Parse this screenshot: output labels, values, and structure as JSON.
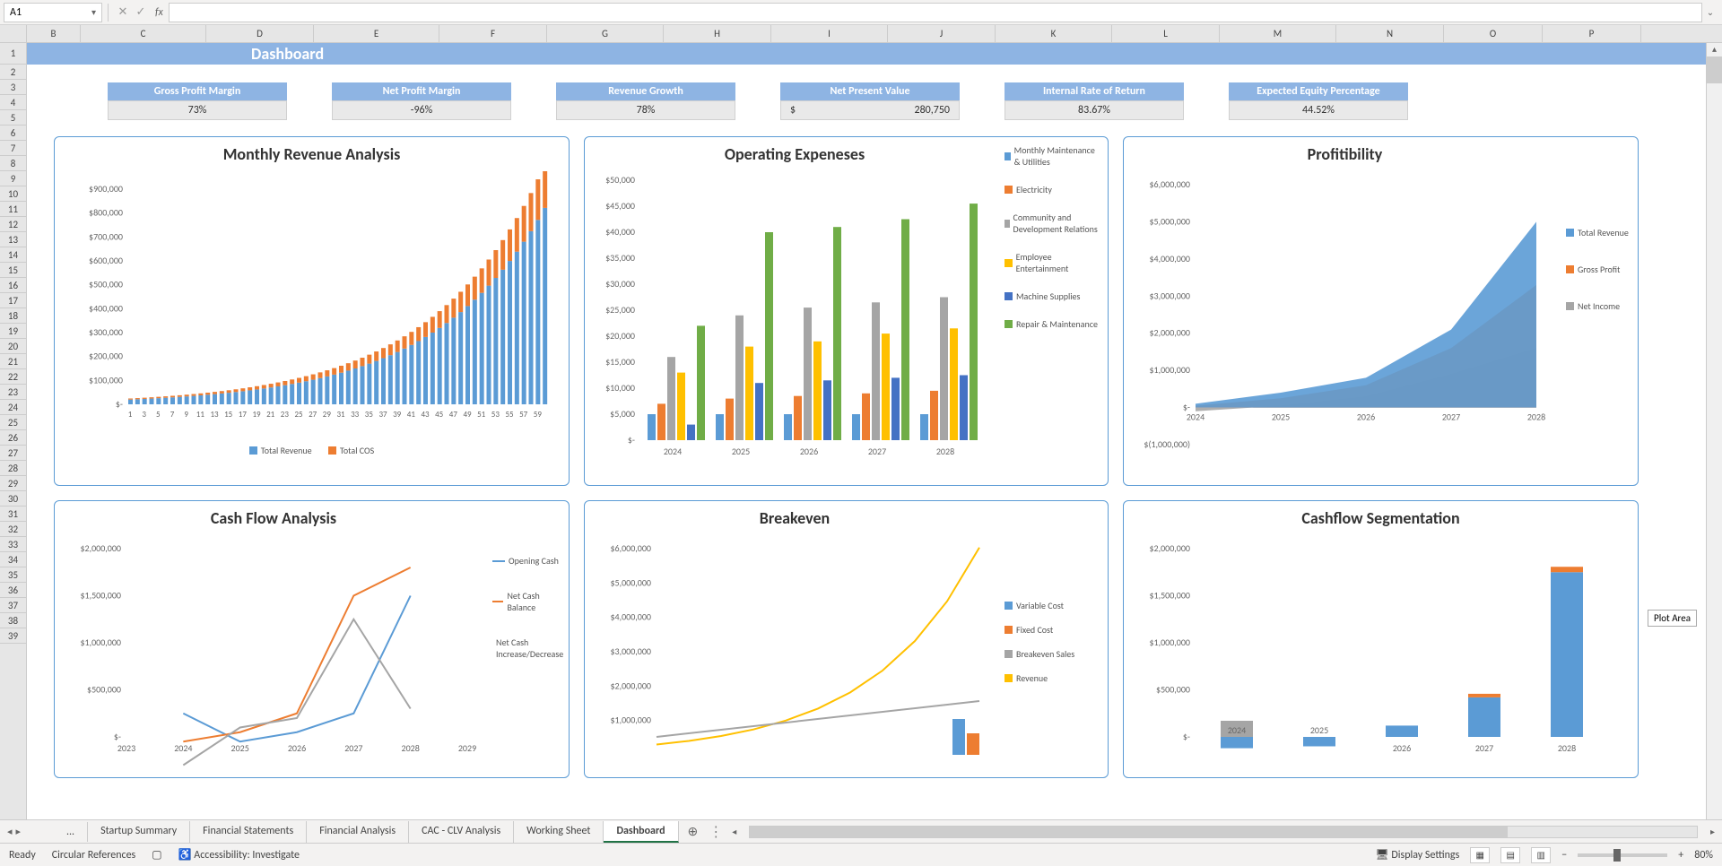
{
  "name_box": "A1",
  "fx_label": "fx",
  "columns": [
    "B",
    "C",
    "D",
    "E",
    "F",
    "G",
    "H",
    "I",
    "J",
    "K",
    "L",
    "M",
    "N",
    "O",
    "P"
  ],
  "rows": [
    1,
    2,
    3,
    4,
    5,
    6,
    7,
    8,
    9,
    10,
    11,
    12,
    13,
    14,
    15,
    16,
    17,
    18,
    19,
    20,
    21,
    22,
    23,
    24,
    25,
    26,
    27,
    28,
    29,
    30,
    31,
    32,
    33,
    34,
    35,
    36,
    37,
    38,
    39
  ],
  "dash_title": "Dashboard",
  "kpis": [
    {
      "label": "Gross Profit Margin",
      "value": "73%"
    },
    {
      "label": "Net Profit Margin",
      "value": "-96%"
    },
    {
      "label": "Revenue Growth",
      "value": "78%"
    },
    {
      "label": "Net Present Value",
      "prefix": "$",
      "value": "280,750"
    },
    {
      "label": "Internal Rate of Return",
      "value": "83.67%"
    },
    {
      "label": "Expected Equity Percentage",
      "value": "44.52%"
    }
  ],
  "chart_titles": {
    "revenue": "Monthly Revenue Analysis",
    "expenses": "Operating Expeneses",
    "profit": "Profitibility",
    "cashflow": "Cash Flow Analysis",
    "breakeven": "Breakeven",
    "cashseg": "Cashflow Segmentation"
  },
  "tooltip": "Plot Area",
  "tabs": {
    "ellipsis": "...",
    "items": [
      "Startup Summary",
      "Financial Statements",
      "Financial Analysis",
      "CAC - CLV Analysis",
      "Working Sheet",
      "Dashboard"
    ],
    "active": "Dashboard"
  },
  "status": {
    "ready": "Ready",
    "circular": "Circular References",
    "accessibility": "Accessibility: Investigate",
    "display": "Display Settings",
    "zoom": "80%"
  },
  "chart_data": [
    {
      "id": "monthly_revenue",
      "type": "bar",
      "title": "Monthly Revenue Analysis",
      "ylabel": "",
      "xlabel": "",
      "ylim": [
        0,
        900000
      ],
      "yticks": [
        "$-",
        "$100,000",
        "$200,000",
        "$300,000",
        "$400,000",
        "$500,000",
        "$600,000",
        "$700,000",
        "$800,000",
        "$900,000"
      ],
      "categories": [
        1,
        3,
        5,
        7,
        9,
        11,
        13,
        15,
        17,
        19,
        21,
        23,
        25,
        27,
        29,
        31,
        33,
        35,
        37,
        39,
        41,
        43,
        45,
        47,
        49,
        51,
        53,
        55,
        57,
        59
      ],
      "series": [
        {
          "name": "Total Revenue",
          "color": "#5B9BD5"
        },
        {
          "name": "Total COS",
          "color": "#ED7D31"
        }
      ],
      "note": "60 stacked bars growing exponentially from ~20000 to ~800000; Total COS caps each Total Revenue bar (~15-25%)."
    },
    {
      "id": "operating_expenses",
      "type": "bar",
      "title": "Operating Expeneses",
      "ylim": [
        0,
        50000
      ],
      "yticks": [
        "$-",
        "$5,000",
        "$10,000",
        "$15,000",
        "$20,000",
        "$25,000",
        "$30,000",
        "$35,000",
        "$40,000",
        "$45,000",
        "$50,000"
      ],
      "categories": [
        "2024",
        "2025",
        "2026",
        "2027",
        "2028"
      ],
      "series": [
        {
          "name": "Monthly Maintenance & Utilities",
          "color": "#5B9BD5",
          "values": [
            5000,
            5000,
            5000,
            5000,
            5000
          ]
        },
        {
          "name": "Electricity",
          "color": "#ED7D31",
          "values": [
            7000,
            8000,
            8500,
            9000,
            9500
          ]
        },
        {
          "name": "Community and Development Relations",
          "color": "#A5A5A5",
          "values": [
            16000,
            24000,
            25500,
            26500,
            27500
          ]
        },
        {
          "name": "Employee Entertainment",
          "color": "#FFC000",
          "values": [
            13000,
            18000,
            19000,
            20500,
            21500
          ]
        },
        {
          "name": "Machine Supplies",
          "color": "#4472C4",
          "values": [
            3000,
            11000,
            11500,
            12000,
            12500
          ]
        },
        {
          "name": "Repair & Maintenance",
          "color": "#70AD47",
          "values": [
            22000,
            40000,
            41000,
            42500,
            45500
          ]
        }
      ]
    },
    {
      "id": "profitability",
      "type": "area",
      "title": "Profitibility",
      "ylim": [
        -1000000,
        6000000
      ],
      "yticks": [
        "$(1,000,000)",
        "$-",
        "$1,000,000",
        "$2,000,000",
        "$3,000,000",
        "$4,000,000",
        "$5,000,000",
        "$6,000,000"
      ],
      "categories": [
        "2024",
        "2025",
        "2026",
        "2027",
        "2028"
      ],
      "series": [
        {
          "name": "Total Revenue",
          "color": "#5B9BD5",
          "values": [
            100000,
            400000,
            800000,
            2100000,
            5000000
          ]
        },
        {
          "name": "Gross Profit",
          "color": "#ED7D31",
          "values": [
            50000,
            250000,
            600000,
            1600000,
            3300000
          ]
        },
        {
          "name": "Net Income",
          "color": "#A5A5A5",
          "values": [
            -100000,
            50000,
            300000,
            900000,
            1600000
          ]
        }
      ]
    },
    {
      "id": "cash_flow_analysis",
      "type": "line",
      "title": "Cash Flow Analysis",
      "ylim": [
        0,
        2000000
      ],
      "yticks": [
        "$-",
        "$500,000",
        "$1,000,000",
        "$1,500,000",
        "$2,000,000"
      ],
      "categories": [
        "2023",
        "2024",
        "2025",
        "2026",
        "2027",
        "2028",
        "2029"
      ],
      "series": [
        {
          "name": "Opening Cash",
          "color": "#5B9BD5",
          "values": [
            null,
            250000,
            -50000,
            50000,
            250000,
            1500000,
            null
          ]
        },
        {
          "name": "Net Cash Balance",
          "color": "#ED7D31",
          "values": [
            null,
            -50000,
            50000,
            250000,
            1500000,
            1800000,
            null
          ]
        },
        {
          "name": "Net Cash Increase/Decrease",
          "color": "#A5A5A5",
          "values": [
            null,
            -300000,
            100000,
            200000,
            1250000,
            300000,
            null
          ]
        }
      ]
    },
    {
      "id": "breakeven",
      "type": "line",
      "title": "Breakeven",
      "ylim": [
        0,
        6000000
      ],
      "yticks": [
        "$1,000,000",
        "$2,000,000",
        "$3,000,000",
        "$4,000,000",
        "$5,000,000",
        "$6,000,000"
      ],
      "series": [
        {
          "name": "Variable Cost",
          "color": "#5B9BD5"
        },
        {
          "name": "Fixed Cost",
          "color": "#ED7D31"
        },
        {
          "name": "Breakeven Sales",
          "color": "#A5A5A5"
        },
        {
          "name": "Revenue",
          "color": "#FFC000"
        }
      ],
      "note": "Revenue line rises steeply from ~300000 to ~5000000; breakeven line gentle; bars at right edge for costs."
    },
    {
      "id": "cashflow_segmentation",
      "type": "bar",
      "title": "Cashflow Segmentation",
      "ylim": [
        0,
        2000000
      ],
      "yticks": [
        "$-",
        "$500,000",
        "$1,000,000",
        "$1,500,000",
        "$2,000,000"
      ],
      "categories": [
        "2024",
        "2025",
        "2026",
        "2027",
        "2028"
      ],
      "values": [
        -120000,
        -100000,
        120000,
        420000,
        1750000
      ],
      "colors": {
        "stack_top_2024": "#A5A5A5",
        "stack_top_2025": "#ED7D31",
        "stack_top_2028": "#ED7D31",
        "main": "#5B9BD5"
      }
    }
  ]
}
